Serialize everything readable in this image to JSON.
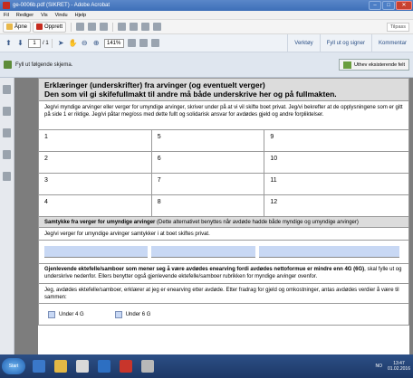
{
  "window": {
    "title": "ge-0006b.pdf (SIKRET) - Adobe Acrobat",
    "btn_min": "–",
    "btn_max": "□",
    "btn_close": "✕"
  },
  "menu": [
    "Fil",
    "Rediger",
    "Vis",
    "Vindu",
    "Hjelp"
  ],
  "toolbar": {
    "open_label": "Åpne",
    "create_label": "Opprett",
    "customize_label": "Tilpass"
  },
  "nav": {
    "page_current": "1",
    "page_total": "/ 1",
    "zoom": "141%"
  },
  "tasks": {
    "tools": "Verktøy",
    "fill_sign": "Fyll ut og signer",
    "comment": "Kommentar"
  },
  "formbar": {
    "message": "Fyll ut følgende skjema.",
    "highlight_label": "Uthev eksisterende felt"
  },
  "document": {
    "title_line1": "Erklæringer (underskrifter) fra arvinger (og eventuelt verger)",
    "title_line2": "Den som vil gi skifefullmakt til andre må både underskrive her og på fullmakten.",
    "intro": "Jeg/vi myndige arvinger eller verger for umyndige arvinger, skriver under på at vi vil skifte boet privat. Jeg/vi bekrefter at de opplysningene som er gitt på side 1 er riktige. Jeg/vi påtar meg/oss med dette fullt og solidarisk ansvar for avdødes gjeld og andre forpliktelser.",
    "grid": [
      [
        "1",
        "5",
        "9"
      ],
      [
        "2",
        "6",
        "10"
      ],
      [
        "3",
        "7",
        "11"
      ],
      [
        "4",
        "8",
        "12"
      ]
    ],
    "consent_bold": "Samtykke fra verger for umyndige arvinger",
    "consent_rest": " (Dette alternativet benyttes når avdøde hadde både myndige og umyndige arvinger)",
    "consent_text": "Jeg/vi verger for umyndige arvinger samtykker i at boet skiftes privat.",
    "spouse_bold": "Gjenlevende ektefelle/samboer som mener seg å være avdødes enearving fordi avdødes nettoformue er mindre enn 4G (6G)",
    "spouse_rest": ", skal fylle ut og underskrive nedenfor. Ellers benytter også gjenlevende ektefelle/samboer rubrikken for myndige arvinger ovenfor.",
    "declare_text": "Jeg, avdødes ektefelle/samboer, erklærer at jeg er enearving etter avdøde. Etter fradrag for gjeld og omkostninger, antas avdødes verdier å være til sammen:",
    "option1": "Under 4 G",
    "option2": "Under 6 G"
  },
  "taskbar": {
    "start": "Start",
    "lang": "NO",
    "time": "13:47",
    "date": "01.02.2016"
  }
}
